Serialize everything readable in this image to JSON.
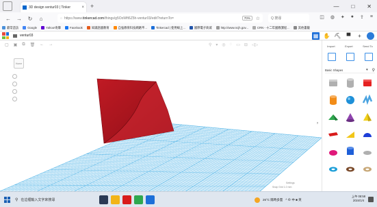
{
  "browser": {
    "tab_title": "3D design ventur03 | Tinker",
    "tab_close": "×",
    "new_tab": "+",
    "window_controls": [
      "—",
      "□",
      "✕"
    ],
    "url_prefix": "https://www.",
    "url_domain": "tinkercad.com",
    "url_rest": "/things/g5OoWft6Z5h-ventur03/edit?returnTo=",
    "zoom": "70%",
    "search_placeholder": "Q 搜尋",
    "nav_icons": [
      "back-icon",
      "forward-icon",
      "reload-icon",
      "home-icon"
    ],
    "right_icons": [
      "pocket-icon",
      "account-icon",
      "extension-icon",
      "star-icon",
      "share-icon",
      "menu-icon"
    ]
  },
  "bookmarks": [
    {
      "label": "最常造訪",
      "color": "#4a90d9"
    },
    {
      "label": "Google",
      "color": "#4285f4"
    },
    {
      "label": "Yahoo!奇摩",
      "color": "#6001d2"
    },
    {
      "label": "Facebook",
      "color": "#1877f2"
    },
    {
      "label": "知識語國教育",
      "color": "#e55a1c"
    },
    {
      "label": "自強教育科技網路平...",
      "color": "#ff8800"
    },
    {
      "label": "Tinkercad | 使用線上...",
      "color": "#1d6fd8"
    },
    {
      "label": "國際電子商城",
      "color": "#2255aa"
    },
    {
      "label": "http://www.ncjh.gov...",
      "color": "#999999"
    },
    {
      "label": "CRN - 十二年國教課程...",
      "color": "#aaaaaa"
    },
    {
      "label": "其他書籤",
      "color": "#888888"
    }
  ],
  "app": {
    "project_name": "ventur03",
    "logo_colors": [
      "#e84b3c",
      "#1d6fd8",
      "#6fbf3b",
      "#f2b418"
    ],
    "tools": [
      "grid-view-icon",
      "hand-icon",
      "pickaxe-icon",
      "bricks-icon",
      "add-user-icon"
    ],
    "edit_tools": [
      "copy-icon",
      "paste-icon",
      "duplicate-icon",
      "delete-icon",
      "undo-icon",
      "redo-icon"
    ],
    "view_tools": [
      "note-icon",
      "light-icon",
      "group-icon",
      "ungroup-icon",
      "align-icon",
      "mirror-icon"
    ]
  },
  "viewport": {
    "home_label": "Home",
    "footer_edit_grid": "Edit Grid",
    "footer_snap_grid": "Snap Grid  1.0 mm",
    "footer_settings": "Settings",
    "object_color": "#b5121b",
    "grid_color": "#5ab8e8"
  },
  "panel": {
    "buttons": [
      "Import",
      "Export",
      "Send To"
    ],
    "shapes_label": "Basic Shapes",
    "shapes": [
      {
        "name": "box-hole-shape",
        "color": "#b0b0b0"
      },
      {
        "name": "cylinder-hole-shape",
        "color": "#b0b0b0"
      },
      {
        "name": "box-shape",
        "color": "#e52222"
      },
      {
        "name": "cylinder-shape",
        "color": "#f28c18"
      },
      {
        "name": "sphere-shape",
        "color": "#1e90d8"
      },
      {
        "name": "scribble-shape",
        "color": "#4aa3e0"
      },
      {
        "name": "roof-shape",
        "color": "#2fa84f"
      },
      {
        "name": "cone-shape",
        "color": "#8e44ad"
      },
      {
        "name": "pyramid-shape",
        "color": "#f2d21b"
      },
      {
        "name": "text-shape",
        "color": "#d81b1b"
      },
      {
        "name": "wedge-shape",
        "color": "#f2c618"
      },
      {
        "name": "half-sphere-shape",
        "color": "#1e3fd8"
      },
      {
        "name": "paraboloid-shape",
        "color": "#e0187a"
      },
      {
        "name": "tube-shape",
        "color": "#1e5fd8"
      },
      {
        "name": "star-shape",
        "color": "#b0b0b0"
      },
      {
        "name": "torus-shape",
        "color": "#1e9fd8"
      },
      {
        "name": "heart-shape",
        "color": "#7a4a2a"
      },
      {
        "name": "polygon-shape",
        "color": "#c8a878"
      }
    ]
  },
  "taskbar": {
    "search_placeholder": "在這裡輸入文字來搜尋",
    "apps": [
      {
        "name": "taskview-icon",
        "color": "#2b3a55"
      },
      {
        "name": "file-explorer-icon",
        "color": "#f2b418"
      },
      {
        "name": "opera-icon",
        "color": "#d81b1b"
      },
      {
        "name": "chrome-icon",
        "color": "#2fa84f"
      },
      {
        "name": "store-icon",
        "color": "#1d6fd8"
      }
    ],
    "weather": "26°C 陽時多雲",
    "tray_icons": "^ ⊕ 中 ■ 英",
    "time": "上午 08:58",
    "date": "2024/1/4"
  }
}
